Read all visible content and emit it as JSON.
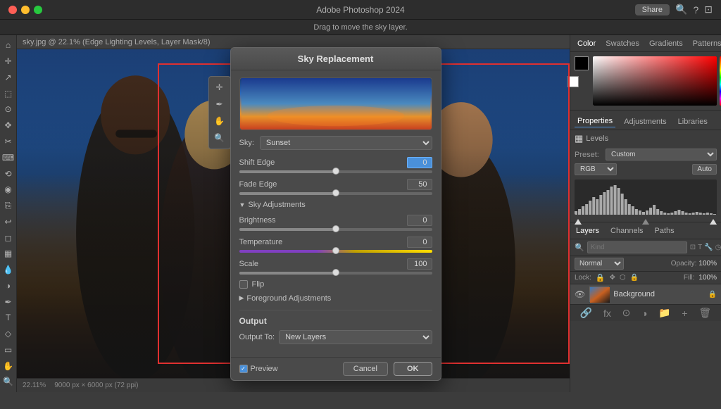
{
  "app": {
    "title": "Adobe Photoshop 2024",
    "info_bar": "Drag to move the sky layer.",
    "share_label": "Share",
    "file_name": "sky.jpg @ 22.1% (Edge Lighting Levels, Layer Mask/8)"
  },
  "toolbar": {
    "tools": [
      "⌂",
      "✛",
      "↖",
      "⬚",
      "⊖",
      "✥",
      "☛",
      "⬡",
      "✂",
      "⌨",
      "⟲",
      "◉",
      "T",
      "✒",
      "✋",
      "✿"
    ]
  },
  "right_panel": {
    "top_tabs": [
      "Color",
      "Swatches",
      "Gradients",
      "Patterns"
    ],
    "properties_tabs": [
      "Properties",
      "Adjustments",
      "Libraries"
    ],
    "prop_section_label": "Levels",
    "preset_label": "Preset:",
    "preset_value": "Custom",
    "channel_label": "RGB",
    "auto_label": "Auto",
    "layers_tabs": [
      "Layers",
      "Channels",
      "Paths"
    ],
    "search_placeholder": "Kind",
    "blend_mode": "Normal",
    "opacity_label": "Opacity:",
    "opacity_value": "100%",
    "lock_label": "Lock:",
    "fill_label": "Fill:",
    "fill_value": "100%",
    "layer_name": "Background"
  },
  "dialog": {
    "title": "Sky Replacement",
    "sky_label": "Sky:",
    "shift_edge_label": "Shift Edge",
    "shift_edge_value": "0",
    "shift_edge_pct": 50,
    "fade_edge_label": "Fade Edge",
    "fade_edge_value": "50",
    "fade_edge_pct": 50,
    "sky_adjustments_label": "Sky Adjustments",
    "brightness_label": "Brightness",
    "brightness_value": "0",
    "brightness_pct": 50,
    "temperature_label": "Temperature",
    "temperature_value": "0",
    "temperature_pct": 50,
    "scale_label": "Scale",
    "scale_value": "100",
    "scale_pct": 50,
    "flip_label": "Flip",
    "foreground_label": "Foreground Adjustments",
    "output_label": "Output",
    "output_to_label": "Output To:",
    "output_to_value": "New Layers",
    "preview_label": "Preview",
    "cancel_label": "Cancel",
    "ok_label": "OK"
  },
  "status_bar": {
    "zoom": "22.11%",
    "dimensions": "9000 px × 6000 px (72 ppi)"
  }
}
